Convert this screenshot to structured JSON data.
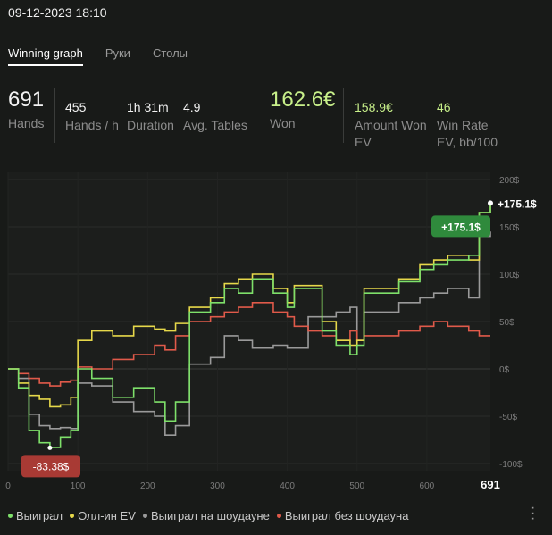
{
  "header": {
    "datetime": "09-12-2023 18:10"
  },
  "tabs": [
    {
      "label": "Winning graph",
      "active": true
    },
    {
      "label": "Руки",
      "active": false
    },
    {
      "label": "Столы",
      "active": false
    }
  ],
  "stats": {
    "hands": {
      "value": "691",
      "label": "Hands"
    },
    "hands_per_hour": {
      "value": "455",
      "label": "Hands / h"
    },
    "duration": {
      "value": "1h 31m",
      "label": "Duration"
    },
    "avg_tables": {
      "value": "4.9",
      "label": "Avg. Tables"
    },
    "won": {
      "value": "162.6€",
      "label": "Won"
    },
    "amount_won_ev": {
      "value": "158.9€",
      "label": "Amount Won EV"
    },
    "win_rate_ev": {
      "value": "46",
      "label": "Win Rate EV, bb/100"
    }
  },
  "legend": [
    {
      "label": "Выиграл",
      "color": "#7ee06a"
    },
    {
      "label": "Олл-ин EV",
      "color": "#e6d84a"
    },
    {
      "label": "Выиграл на шоудауне",
      "color": "#9a9a9a"
    },
    {
      "label": "Выиграл без шоудауна",
      "color": "#e05a4a"
    }
  ],
  "kebab_icon": "more-vertical-icon",
  "chart_data": {
    "type": "line",
    "x_max_label": "691",
    "x_ticks": [
      "0",
      "100",
      "200",
      "300",
      "400",
      "500",
      "600"
    ],
    "y_ticks": [
      "200$",
      "150$",
      "100$",
      "50$",
      "0$",
      "-50$",
      "-100$"
    ],
    "xlim": [
      0,
      691
    ],
    "ylim": [
      -100,
      200
    ],
    "annotations": {
      "max": {
        "label": "+175.1$",
        "value": 175.1
      },
      "min": {
        "label": "-83.38$",
        "value": -83.38
      },
      "end": {
        "label": "+175.1$"
      }
    },
    "series": [
      {
        "name": "Выиграл",
        "color": "#7ee06a",
        "x": [
          0,
          15,
          30,
          45,
          60,
          75,
          90,
          100,
          120,
          150,
          180,
          210,
          225,
          240,
          260,
          290,
          310,
          330,
          350,
          380,
          400,
          410,
          430,
          450,
          470,
          490,
          500,
          510,
          530,
          560,
          590,
          610,
          630,
          660,
          675,
          691
        ],
        "y": [
          0,
          -20,
          -65,
          -78,
          -83,
          -72,
          -65,
          0,
          -10,
          -30,
          -20,
          -35,
          -55,
          -35,
          60,
          70,
          85,
          80,
          95,
          80,
          65,
          85,
          85,
          40,
          25,
          15,
          25,
          80,
          80,
          92,
          105,
          110,
          115,
          120,
          165,
          175
        ]
      },
      {
        "name": "Олл-ин EV",
        "color": "#e6d84a",
        "x": [
          0,
          15,
          30,
          45,
          60,
          75,
          90,
          100,
          120,
          150,
          180,
          210,
          225,
          240,
          260,
          290,
          310,
          330,
          350,
          380,
          400,
          410,
          430,
          450,
          470,
          490,
          500,
          510,
          530,
          560,
          590,
          610,
          630,
          660,
          675,
          691
        ],
        "y": [
          0,
          -15,
          -28,
          -32,
          -40,
          -38,
          -30,
          30,
          40,
          35,
          45,
          42,
          40,
          48,
          65,
          75,
          90,
          95,
          100,
          85,
          70,
          88,
          88,
          50,
          30,
          25,
          30,
          85,
          85,
          95,
          110,
          115,
          120,
          115,
          165,
          172
        ]
      },
      {
        "name": "Выиграл на шоудауне",
        "color": "#9a9a9a",
        "x": [
          0,
          15,
          30,
          45,
          60,
          75,
          90,
          100,
          120,
          150,
          180,
          210,
          225,
          240,
          260,
          290,
          310,
          330,
          350,
          380,
          400,
          410,
          430,
          450,
          470,
          490,
          500,
          510,
          530,
          560,
          590,
          610,
          630,
          660,
          675,
          691
        ],
        "y": [
          0,
          -10,
          -48,
          -60,
          -63,
          -62,
          -63,
          -15,
          -18,
          -35,
          -45,
          -50,
          -70,
          -60,
          5,
          12,
          35,
          30,
          22,
          25,
          22,
          22,
          55,
          55,
          60,
          65,
          30,
          60,
          60,
          70,
          75,
          80,
          85,
          75,
          140,
          145
        ]
      },
      {
        "name": "Выиграл без шоудауна",
        "color": "#e05a4a",
        "x": [
          0,
          15,
          30,
          45,
          60,
          75,
          90,
          100,
          120,
          150,
          180,
          210,
          225,
          240,
          260,
          290,
          310,
          330,
          350,
          380,
          400,
          410,
          430,
          450,
          470,
          490,
          500,
          510,
          530,
          560,
          590,
          610,
          630,
          660,
          675,
          691
        ],
        "y": [
          0,
          -5,
          -10,
          -15,
          -18,
          -14,
          -12,
          2,
          0,
          10,
          15,
          25,
          20,
          35,
          50,
          55,
          60,
          65,
          70,
          60,
          55,
          45,
          40,
          35,
          30,
          40,
          30,
          35,
          35,
          40,
          45,
          50,
          45,
          40,
          35,
          35
        ]
      }
    ]
  }
}
